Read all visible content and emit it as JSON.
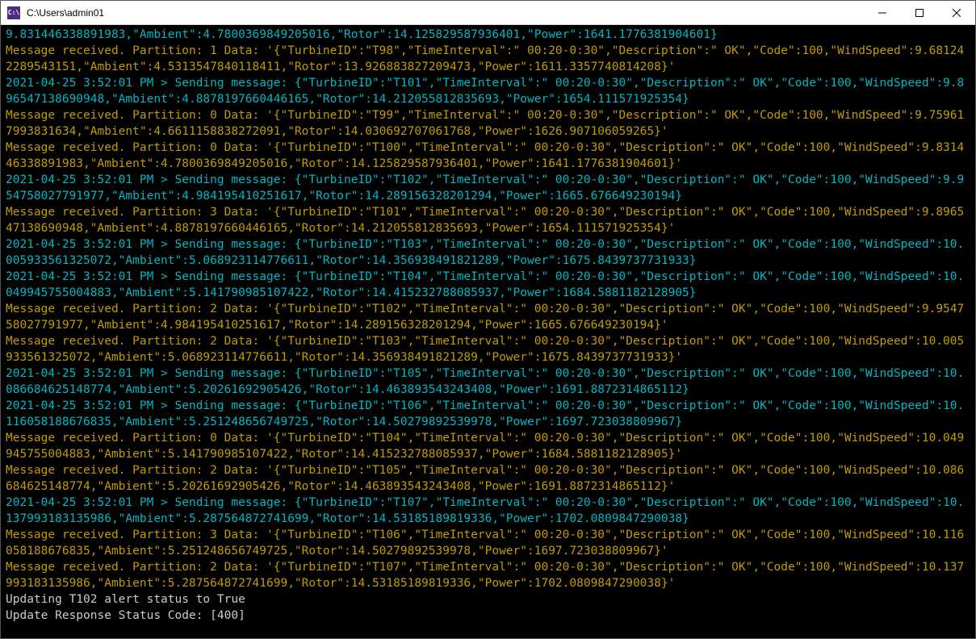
{
  "window": {
    "title": "C:\\Users\\admin01",
    "icon_text": "C:\\"
  },
  "lines": [
    {
      "type": "sending",
      "text": "9.831446338891983,\"Ambient\":4.7800369849205016,\"Rotor\":14.125829587936401,\"Power\":1641.1776381904601}"
    },
    {
      "type": "received",
      "text": "Message received. Partition: 1 Data: '{\"TurbineID\":\"T98\",\"TimeInterval\":\" 00:20-0:30\",\"Description\":\" OK\",\"Code\":100,\"WindSpeed\":9.681242289543151,\"Ambient\":4.5313547840118411,\"Rotor\":13.926883827209473,\"Power\":1611.3357740814208}'"
    },
    {
      "type": "sending",
      "text": "2021-04-25 3:52:01 PM > Sending message: {\"TurbineID\":\"T101\",\"TimeInterval\":\" 00:20-0:30\",\"Description\":\" OK\",\"Code\":100,\"WindSpeed\":9.896547138690948,\"Ambient\":4.8878197660446165,\"Rotor\":14.212055812835693,\"Power\":1654.111571925354}"
    },
    {
      "type": "received",
      "text": "Message received. Partition: 0 Data: '{\"TurbineID\":\"T99\",\"TimeInterval\":\" 00:20-0:30\",\"Description\":\" OK\",\"Code\":100,\"WindSpeed\":9.759617993831634,\"Ambient\":4.6611158838272091,\"Rotor\":14.030692707061768,\"Power\":1626.907106059265}'"
    },
    {
      "type": "received",
      "text": "Message received. Partition: 0 Data: '{\"TurbineID\":\"T100\",\"TimeInterval\":\" 00:20-0:30\",\"Description\":\" OK\",\"Code\":100,\"WindSpeed\":9.831446338891983,\"Ambient\":4.7800369849205016,\"Rotor\":14.125829587936401,\"Power\":1641.1776381904601}'"
    },
    {
      "type": "sending",
      "text": "2021-04-25 3:52:01 PM > Sending message: {\"TurbineID\":\"T102\",\"TimeInterval\":\" 00:20-0:30\",\"Description\":\" OK\",\"Code\":100,\"WindSpeed\":9.954758027791977,\"Ambient\":4.984195410251617,\"Rotor\":14.289156328201294,\"Power\":1665.676649230194}"
    },
    {
      "type": "received",
      "text": "Message received. Partition: 3 Data: '{\"TurbineID\":\"T101\",\"TimeInterval\":\" 00:20-0:30\",\"Description\":\" OK\",\"Code\":100,\"WindSpeed\":9.896547138690948,\"Ambient\":4.8878197660446165,\"Rotor\":14.212055812835693,\"Power\":1654.111571925354}'"
    },
    {
      "type": "sending",
      "text": "2021-04-25 3:52:01 PM > Sending message: {\"TurbineID\":\"T103\",\"TimeInterval\":\" 00:20-0:30\",\"Description\":\" OK\",\"Code\":100,\"WindSpeed\":10.005933561325072,\"Ambient\":5.068923114776611,\"Rotor\":14.356938491821289,\"Power\":1675.8439737731933}"
    },
    {
      "type": "sending",
      "text": "2021-04-25 3:52:01 PM > Sending message: {\"TurbineID\":\"T104\",\"TimeInterval\":\" 00:20-0:30\",\"Description\":\" OK\",\"Code\":100,\"WindSpeed\":10.049945755004883,\"Ambient\":5.141790985107422,\"Rotor\":14.415232788085937,\"Power\":1684.5881182128905}"
    },
    {
      "type": "received",
      "text": "Message received. Partition: 2 Data: '{\"TurbineID\":\"T102\",\"TimeInterval\":\" 00:20-0:30\",\"Description\":\" OK\",\"Code\":100,\"WindSpeed\":9.954758027791977,\"Ambient\":4.984195410251617,\"Rotor\":14.289156328201294,\"Power\":1665.676649230194}'"
    },
    {
      "type": "received",
      "text": "Message received. Partition: 2 Data: '{\"TurbineID\":\"T103\",\"TimeInterval\":\" 00:20-0:30\",\"Description\":\" OK\",\"Code\":100,\"WindSpeed\":10.005933561325072,\"Ambient\":5.068923114776611,\"Rotor\":14.356938491821289,\"Power\":1675.8439737731933}'"
    },
    {
      "type": "sending",
      "text": "2021-04-25 3:52:01 PM > Sending message: {\"TurbineID\":\"T105\",\"TimeInterval\":\" 00:20-0:30\",\"Description\":\" OK\",\"Code\":100,\"WindSpeed\":10.086684625148774,\"Ambient\":5.20261692905426,\"Rotor\":14.463893543243408,\"Power\":1691.8872314865112}"
    },
    {
      "type": "sending",
      "text": "2021-04-25 3:52:01 PM > Sending message: {\"TurbineID\":\"T106\",\"TimeInterval\":\" 00:20-0:30\",\"Description\":\" OK\",\"Code\":100,\"WindSpeed\":10.116058188676835,\"Ambient\":5.251248656749725,\"Rotor\":14.50279892539978,\"Power\":1697.723038809967}"
    },
    {
      "type": "received",
      "text": "Message received. Partition: 0 Data: '{\"TurbineID\":\"T104\",\"TimeInterval\":\" 00:20-0:30\",\"Description\":\" OK\",\"Code\":100,\"WindSpeed\":10.049945755004883,\"Ambient\":5.141790985107422,\"Rotor\":14.415232788085937,\"Power\":1684.5881182128905}'"
    },
    {
      "type": "received",
      "text": "Message received. Partition: 2 Data: '{\"TurbineID\":\"T105\",\"TimeInterval\":\" 00:20-0:30\",\"Description\":\" OK\",\"Code\":100,\"WindSpeed\":10.086684625148774,\"Ambient\":5.20261692905426,\"Rotor\":14.463893543243408,\"Power\":1691.8872314865112}'"
    },
    {
      "type": "sending",
      "text": "2021-04-25 3:52:01 PM > Sending message: {\"TurbineID\":\"T107\",\"TimeInterval\":\" 00:20-0:30\",\"Description\":\" OK\",\"Code\":100,\"WindSpeed\":10.137993183135986,\"Ambient\":5.287564872741699,\"Rotor\":14.53185189819336,\"Power\":1702.0809847290038}"
    },
    {
      "type": "received",
      "text": "Message received. Partition: 3 Data: '{\"TurbineID\":\"T106\",\"TimeInterval\":\" 00:20-0:30\",\"Description\":\" OK\",\"Code\":100,\"WindSpeed\":10.116058188676835,\"Ambient\":5.251248656749725,\"Rotor\":14.50279892539978,\"Power\":1697.723038809967}'"
    },
    {
      "type": "received",
      "text": "Message received. Partition: 2 Data: '{\"TurbineID\":\"T107\",\"TimeInterval\":\" 00:20-0:30\",\"Description\":\" OK\",\"Code\":100,\"WindSpeed\":10.137993183135986,\"Ambient\":5.287564872741699,\"Rotor\":14.53185189819336,\"Power\":1702.0809847290038}'"
    },
    {
      "type": "info",
      "text": "Updating T102 alert status to True"
    },
    {
      "type": "info",
      "text": "Update Response Status Code: [400]"
    }
  ]
}
